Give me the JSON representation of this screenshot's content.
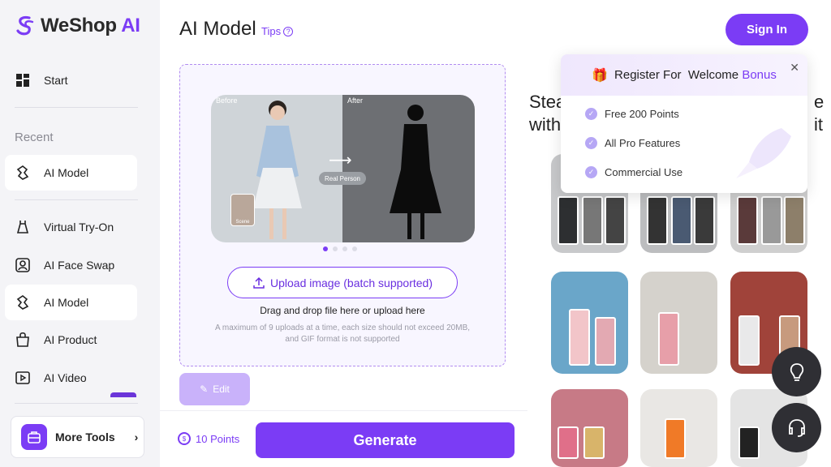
{
  "brand": {
    "name": "WeShop",
    "suffix": "AI"
  },
  "sidebar": {
    "start": "Start",
    "recent_label": "Recent",
    "recent_item": "AI Model",
    "items": [
      {
        "label": "Virtual Try-On",
        "icon": "dress-icon"
      },
      {
        "label": "AI Face Swap",
        "icon": "face-swap-icon"
      },
      {
        "label": "AI Model",
        "icon": "ai-model-icon"
      },
      {
        "label": "AI Product",
        "icon": "bag-icon"
      },
      {
        "label": "AI Video",
        "icon": "video-icon"
      }
    ],
    "more_tools": "More Tools"
  },
  "main": {
    "title": "AI Model",
    "tips": "Tips",
    "preview": {
      "before": "Before",
      "after": "After",
      "chip": "Real Person",
      "thumb": "Scene"
    },
    "upload_label": "Upload image (batch supported)",
    "drag_text": "Drag and drop file here or upload here",
    "limit_text": "A maximum of 9 uploads at a time, each size should not exceed 20MB, and GIF format is not supported",
    "edit": "Edit",
    "points": "10 Points",
    "generate": "Generate"
  },
  "right": {
    "sign_in": "Sign In",
    "heading_line1": "Stea",
    "heading_line2": "with",
    "heading_tail": "e it"
  },
  "popup": {
    "title_prefix": "Register For",
    "title_mid": "Welcome",
    "title_bonus": "Bonus",
    "perks": [
      "Free 200 Points",
      "All Pro Features",
      "Commercial Use"
    ]
  },
  "colors": {
    "accent": "#7b3cf5",
    "sidebar_bg": "#f4f4f7",
    "upload_bg": "#f8f6ff"
  }
}
